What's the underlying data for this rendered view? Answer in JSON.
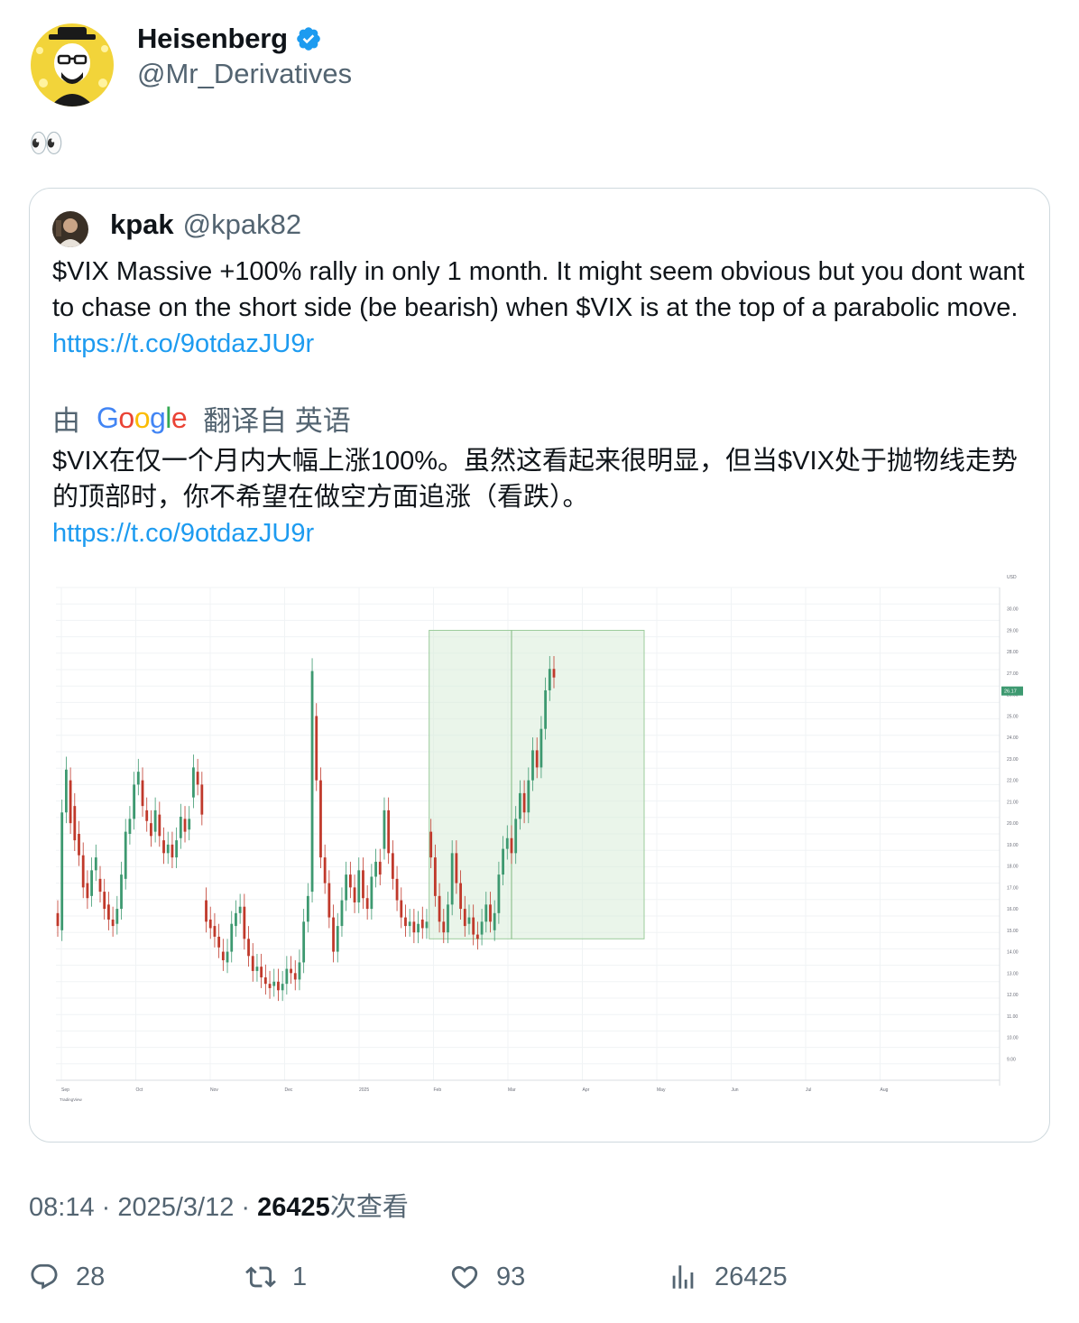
{
  "author": {
    "display_name": "Heisenberg",
    "handle": "@Mr_Derivatives",
    "avatar_icon": "heisenberg-avatar-icon",
    "verified_icon": "verified-badge-icon"
  },
  "tweet": {
    "text": "👀"
  },
  "quote": {
    "display_name": "kpak",
    "handle": "@kpak82",
    "text": "$VIX Massive +100% rally in only 1 month. It might seem obvious but you dont want to chase on the short side (be bearish) when $VIX is at the top of a parabolic move.",
    "link": "https://t.co/9otdazJU9r",
    "translate_prefix": "由",
    "translate_brand": "Google",
    "translate_suffix": "翻译自 英语",
    "translated_text": "$VIX在仅一个月内大幅上涨100%。虽然这看起来很明显，但当$VIX处于抛物线走势的顶部时，你不希望在做空方面追涨（看跌）。",
    "translated_link": "https://t.co/9otdazJU9r"
  },
  "chart_data": {
    "type": "candlestick",
    "x_ticks": [
      "Sep",
      "Oct",
      "Nov",
      "Dec",
      "2025",
      "Feb",
      "Mar",
      "Apr",
      "May",
      "Jun",
      "Jul",
      "Aug"
    ],
    "y_ticks": [
      "USD",
      "30.00",
      "29.00",
      "28.00",
      "27.00",
      "26.00",
      "25.00",
      "24.00",
      "23.00",
      "22.00",
      "21.00",
      "20.00",
      "19.00",
      "18.00",
      "17.00",
      "16.00",
      "15.00",
      "14.00",
      "13.00",
      "12.00",
      "11.00",
      "10.00",
      "9.00"
    ],
    "last_price": "26.17",
    "brand": "TradingView",
    "ylim": [
      8,
      31
    ],
    "measure_range": [
      14.6,
      29.0
    ],
    "colors": {
      "up": "#3d9970",
      "down": "#c0392b",
      "measure": "#d9ecd9"
    },
    "candles": [
      [
        15.8,
        15.2
      ],
      [
        15.0,
        20.5
      ],
      [
        20.5,
        22.5
      ],
      [
        22.0,
        20.0
      ],
      [
        20.8,
        19.2
      ],
      [
        19.5,
        18.5
      ],
      [
        18.5,
        17.0
      ],
      [
        17.2,
        16.5
      ],
      [
        16.6,
        17.8
      ],
      [
        17.8,
        18.4
      ],
      [
        17.4,
        16.8
      ],
      [
        16.8,
        16.0
      ],
      [
        16.2,
        15.5
      ],
      [
        15.5,
        15.2
      ],
      [
        15.3,
        16.0
      ],
      [
        16.0,
        17.6
      ],
      [
        17.4,
        19.6
      ],
      [
        19.5,
        20.2
      ],
      [
        20.2,
        21.8
      ],
      [
        21.8,
        22.4
      ],
      [
        22.0,
        20.8
      ],
      [
        20.6,
        20.1
      ],
      [
        20.0,
        19.4
      ],
      [
        19.6,
        20.6
      ],
      [
        20.4,
        19.4
      ],
      [
        19.2,
        18.6
      ],
      [
        18.6,
        19.0
      ],
      [
        19.0,
        18.4
      ],
      [
        18.4,
        19.2
      ],
      [
        19.3,
        20.3
      ],
      [
        20.2,
        19.6
      ],
      [
        19.7,
        20.2
      ],
      [
        21.2,
        22.6
      ],
      [
        22.4,
        21.8
      ],
      [
        21.8,
        20.4
      ],
      [
        16.4,
        15.4
      ],
      [
        15.5,
        15.1
      ],
      [
        15.2,
        14.7
      ],
      [
        14.7,
        14.2
      ],
      [
        14.0,
        13.6
      ],
      [
        13.5,
        14.0
      ],
      [
        14.0,
        15.3
      ],
      [
        15.2,
        15.8
      ],
      [
        15.8,
        16.1
      ],
      [
        16.1,
        14.6
      ],
      [
        14.6,
        13.8
      ],
      [
        13.8,
        13.1
      ],
      [
        13.1,
        13.3
      ],
      [
        13.3,
        12.8
      ],
      [
        12.8,
        12.5
      ],
      [
        12.5,
        12.3
      ],
      [
        12.4,
        12.6
      ],
      [
        12.6,
        12.2
      ],
      [
        12.2,
        12.5
      ],
      [
        12.5,
        13.2
      ],
      [
        13.2,
        13.0
      ],
      [
        13.0,
        12.7
      ],
      [
        12.7,
        13.5
      ],
      [
        13.5,
        15.4
      ],
      [
        15.4,
        16.6
      ],
      [
        16.8,
        27.1
      ],
      [
        25.0,
        22.0
      ],
      [
        22.0,
        18.4
      ],
      [
        18.4,
        17.2
      ],
      [
        17.2,
        15.6
      ],
      [
        15.6,
        14.0
      ],
      [
        14.0,
        15.2
      ],
      [
        15.2,
        16.4
      ],
      [
        16.4,
        17.6
      ],
      [
        17.6,
        17.0
      ],
      [
        17.0,
        16.3
      ],
      [
        16.3,
        17.8
      ],
      [
        17.8,
        16.5
      ],
      [
        16.5,
        16.0
      ],
      [
        16.0,
        17.5
      ],
      [
        17.5,
        18.2
      ],
      [
        18.2,
        17.6
      ],
      [
        18.8,
        20.6
      ],
      [
        20.6,
        18.6
      ],
      [
        18.6,
        17.4
      ],
      [
        17.4,
        16.4
      ],
      [
        16.4,
        15.6
      ],
      [
        15.6,
        15.2
      ],
      [
        15.2,
        15.4
      ],
      [
        15.4,
        14.9
      ],
      [
        14.9,
        15.3
      ],
      [
        15.5,
        15.1
      ],
      [
        15.1,
        15.4
      ],
      [
        19.6,
        18.4
      ],
      [
        18.4,
        16.6
      ],
      [
        16.6,
        15.4
      ],
      [
        15.4,
        14.9
      ],
      [
        14.9,
        16.2
      ],
      [
        16.2,
        18.6
      ],
      [
        18.6,
        17.2
      ],
      [
        17.2,
        16.0
      ],
      [
        16.0,
        15.2
      ],
      [
        15.3,
        15.6
      ],
      [
        15.6,
        14.8
      ],
      [
        14.8,
        14.6
      ],
      [
        14.8,
        15.4
      ],
      [
        15.4,
        16.2
      ],
      [
        16.2,
        15.4
      ],
      [
        15.0,
        15.8
      ],
      [
        15.8,
        17.6
      ],
      [
        17.6,
        18.8
      ],
      [
        18.8,
        19.3
      ],
      [
        19.3,
        18.6
      ],
      [
        18.6,
        20.2
      ],
      [
        20.2,
        21.4
      ],
      [
        21.4,
        20.5
      ],
      [
        20.5,
        22.0
      ],
      [
        22.0,
        23.4
      ],
      [
        23.4,
        22.6
      ],
      [
        22.6,
        24.4
      ],
      [
        24.4,
        26.2
      ],
      [
        26.2,
        27.2
      ],
      [
        27.2,
        26.8
      ]
    ]
  },
  "meta": {
    "time": "08:14",
    "date": "2025/3/12",
    "views": "26425",
    "views_label": "次查看"
  },
  "actions": {
    "replies": "28",
    "retweets": "1",
    "likes": "93",
    "views": "26425"
  }
}
